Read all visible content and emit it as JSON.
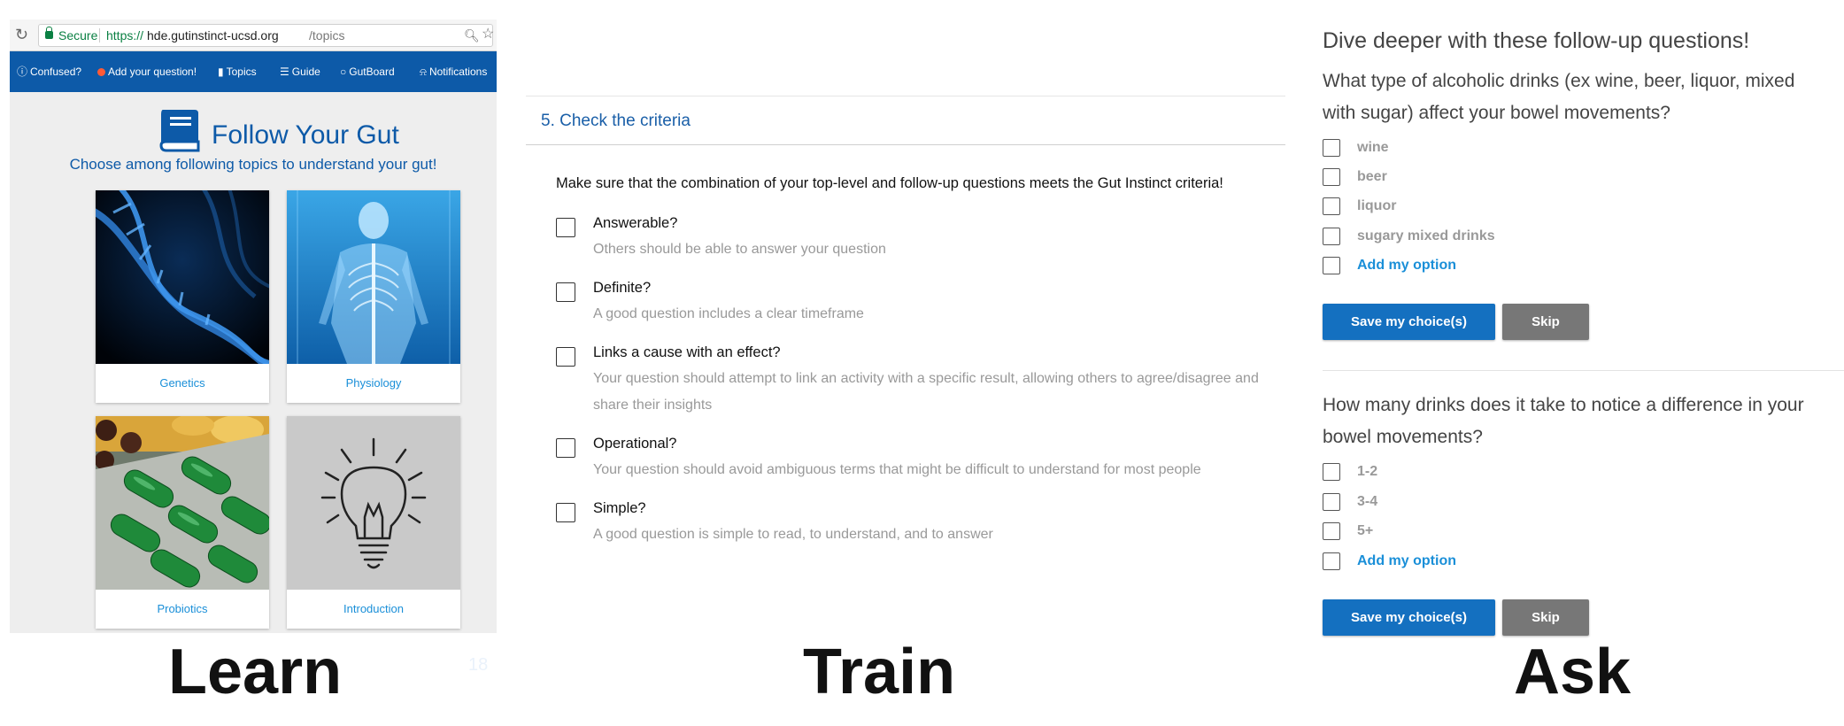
{
  "learn": {
    "browser": {
      "secure_label": "Secure",
      "url_scheme": "https://",
      "url_host": "hde.gutinstinct-ucsd.org",
      "url_path": "/topics"
    },
    "nav": [
      {
        "icon": "question-circle-icon",
        "label": "Confused?"
      },
      {
        "icon": "add-circle-icon",
        "label": "Add your question!"
      },
      {
        "icon": "book-icon",
        "label": "Topics"
      },
      {
        "icon": "list-icon",
        "label": "Guide"
      },
      {
        "icon": "chat-icon",
        "label": "GutBoard"
      },
      {
        "icon": "bell-icon",
        "label": "Notifications"
      }
    ],
    "title": "Follow Your Gut",
    "subtitle": "Choose among following topics to understand your gut!",
    "topics": [
      {
        "label": "Genetics",
        "image": "dna-helix"
      },
      {
        "label": "Physiology",
        "image": "human-body-xray"
      },
      {
        "label": "Probiotics",
        "image": "green-capsules"
      },
      {
        "label": "Introduction",
        "image": "light-bulb"
      }
    ]
  },
  "train": {
    "heading": "5. Check the criteria",
    "intro": "Make sure that the combination of your top-level and follow-up questions meets the Gut Instinct criteria!",
    "criteria": [
      {
        "title": "Answerable?",
        "desc": "Others should be able to answer your question"
      },
      {
        "title": "Definite?",
        "desc": "A good question includes a clear timeframe"
      },
      {
        "title": "Links a cause with an effect?",
        "desc": "Your question should attempt to link an activity with a specific result, allowing others to agree/disagree and share their insights"
      },
      {
        "title": "Operational?",
        "desc": "Your question should avoid ambiguous terms that might be difficult to understand for most people"
      },
      {
        "title": "Simple?",
        "desc": "A good question is simple to read, to understand, and to answer"
      }
    ]
  },
  "ask": {
    "header": "Dive deeper with these follow-up questions!",
    "questions": [
      {
        "text": "What type of alcoholic drinks (ex wine, beer, liquor, mixed with sugar) affect your bowel movements?",
        "options": [
          "wine",
          "beer",
          "liquor",
          "sugary mixed drinks"
        ],
        "add_option": "Add my option",
        "save_label": "Save my choice(s)",
        "skip_label": "Skip"
      },
      {
        "text": "How many drinks does it take to notice a difference in your bowel movements?",
        "options": [
          "1-2",
          "3-4",
          "5+"
        ],
        "add_option": "Add my option",
        "save_label": "Save my choice(s)",
        "skip_label": "Skip"
      }
    ]
  },
  "labels": {
    "learn": "Learn",
    "train": "Train",
    "ask": "Ask"
  },
  "page_number": "18"
}
